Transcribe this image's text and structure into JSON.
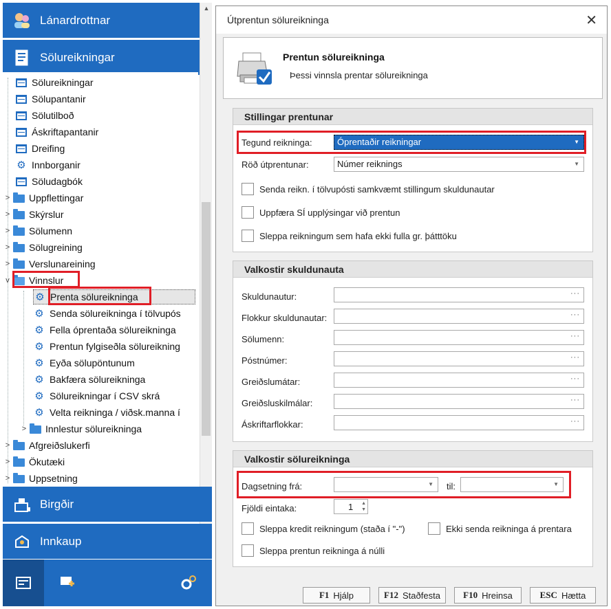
{
  "nav": {
    "top_sections": [
      {
        "label": "Lánardrottnar",
        "icon": "people-icon"
      },
      {
        "label": "Sölureikningar",
        "icon": "invoice-icon"
      }
    ],
    "tree": [
      {
        "label": "Sölureikningar",
        "icon": "list-icon",
        "level": 0,
        "expander": ""
      },
      {
        "label": "Sölupantanir",
        "icon": "list-icon",
        "level": 0,
        "expander": ""
      },
      {
        "label": "Sölutilboð",
        "icon": "list-icon",
        "level": 0,
        "expander": ""
      },
      {
        "label": "Áskriftapantanir",
        "icon": "list-icon",
        "level": 0,
        "expander": ""
      },
      {
        "label": "Dreifing",
        "icon": "list-icon",
        "level": 0,
        "expander": ""
      },
      {
        "label": "Innborganir",
        "icon": "gear-icon",
        "level": 0,
        "expander": ""
      },
      {
        "label": "Söludagbók",
        "icon": "list-icon",
        "level": 0,
        "expander": ""
      },
      {
        "label": "Uppflettingar",
        "icon": "folder-icon",
        "level": 0,
        "expander": ">"
      },
      {
        "label": "Skýrslur",
        "icon": "folder-icon",
        "level": 0,
        "expander": ">"
      },
      {
        "label": "Sölumenn",
        "icon": "folder-icon",
        "level": 0,
        "expander": ">"
      },
      {
        "label": "Sölugreining",
        "icon": "folder-icon",
        "level": 0,
        "expander": ">"
      },
      {
        "label": "Verslunareining",
        "icon": "folder-icon",
        "level": 0,
        "expander": ">"
      },
      {
        "label": "Vinnslur",
        "icon": "folder-open-icon",
        "level": 0,
        "expander": "v"
      },
      {
        "label": "Prenta sölureikninga",
        "icon": "gear-icon",
        "level": 1,
        "expander": ""
      },
      {
        "label": "Senda sölureikninga í tölvupós",
        "icon": "gear-icon",
        "level": 1,
        "expander": ""
      },
      {
        "label": "Fella óprentaða sölureikninga",
        "icon": "gear-icon",
        "level": 1,
        "expander": ""
      },
      {
        "label": "Prentun fylgiseðla sölureikning",
        "icon": "gear-icon",
        "level": 1,
        "expander": ""
      },
      {
        "label": "Eyða sölupöntunum",
        "icon": "gear-icon",
        "level": 1,
        "expander": ""
      },
      {
        "label": "Bakfæra sölureikninga",
        "icon": "gear-icon",
        "level": 1,
        "expander": ""
      },
      {
        "label": "Sölureikningar í CSV skrá",
        "icon": "gear-icon",
        "level": 1,
        "expander": ""
      },
      {
        "label": "Velta reikninga / viðsk.manna í",
        "icon": "gear-icon",
        "level": 1,
        "expander": ""
      },
      {
        "label": "Innlestur sölureikninga",
        "icon": "folder-icon",
        "level": 1,
        "expander": ">"
      },
      {
        "label": "Afgreiðslukerfi",
        "icon": "folder-icon",
        "level": 0,
        "expander": ">"
      },
      {
        "label": "Ökutæki",
        "icon": "folder-icon",
        "level": 0,
        "expander": ">"
      },
      {
        "label": "Uppsetning",
        "icon": "folder-icon",
        "level": 0,
        "expander": ">"
      }
    ],
    "bottom_sections": [
      {
        "label": "Birgðir",
        "icon": "warehouse-icon"
      },
      {
        "label": "Innkaup",
        "icon": "purchase-icon"
      }
    ]
  },
  "dialog": {
    "title": "Útprentun sölureikninga",
    "header_title": "Prentun sölureikninga",
    "header_desc": "Þessi vinnsla prentar sölureikninga",
    "print_settings": {
      "heading": "Stillingar prentunar",
      "invoice_type_label": "Tegund reikninga:",
      "invoice_type_value": "Óprentaðir reikningar",
      "print_order_label": "Röð útprentunar:",
      "print_order_value": "Númer reiknings",
      "checkboxes": [
        "Senda reikn. í tölvupósti samkvæmt stillingum skuldunautar",
        "Uppfæra SÍ upplýsingar við prentun",
        "Sleppa reikningum sem hafa ekki fulla gr. þátttöku"
      ]
    },
    "customer_options": {
      "heading": "Valkostir skuldunauta",
      "fields": [
        "Skuldunautur:",
        "Flokkur skuldunautar:",
        "Sölumenn:",
        "Póstnúmer:",
        "Greiðslumátar:",
        "Greiðsluskilmálar:",
        "Áskriftarflokkar:"
      ]
    },
    "invoice_options": {
      "heading": "Valkostir sölureikninga",
      "date_from_label": "Dagsetning frá:",
      "date_to_label": "til:",
      "copies_label": "Fjöldi eintaka:",
      "copies_value": "1",
      "skip_credit": "Sleppa kredit reikningum (staða í \"-\")",
      "no_send_printer": "Ekki senda reikninga á prentara",
      "skip_zero": "Sleppa prentun reikninga á núlli"
    },
    "buttons": [
      {
        "key": "F1",
        "label": "Hjálp"
      },
      {
        "key": "F12",
        "label": "Staðfesta"
      },
      {
        "key": "F10",
        "label": "Hreinsa"
      },
      {
        "key": "ESC",
        "label": "Hætta"
      }
    ]
  }
}
